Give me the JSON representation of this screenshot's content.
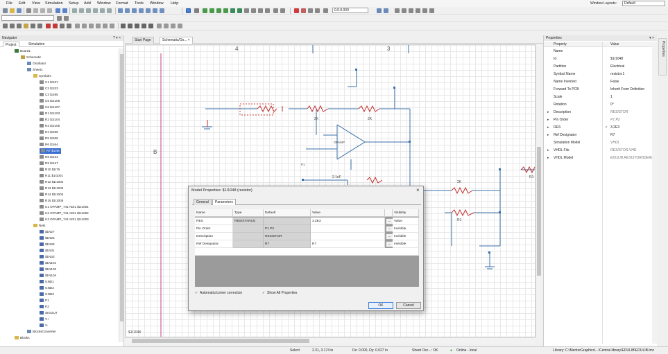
{
  "menu": [
    "File",
    "Edit",
    "View",
    "Simulation",
    "Setup",
    "Add",
    "Window",
    "Format",
    "Tools",
    "Window",
    "Help"
  ],
  "window_layouts": {
    "label": "Window Layouts:",
    "value": "Default"
  },
  "toolbar": {
    "zoom_value": "0.0.0.000"
  },
  "navigator": {
    "title": "Navigator",
    "tabs": [
      "Project",
      "Simulation"
    ],
    "tree": [
      {
        "label": "Board1",
        "level": 1,
        "icon": "board-icon"
      },
      {
        "label": "Schematic",
        "level": 2,
        "icon": "schematic-icon"
      },
      {
        "label": "Oscillator",
        "level": 3,
        "icon": "sheet-icon"
      },
      {
        "label": "Sheet1",
        "level": 3,
        "icon": "sheet-icon"
      },
      {
        "label": "Symbols",
        "level": 4,
        "icon": "folder-icon"
      },
      {
        "label": "C1 $1I27",
        "level": 5,
        "icon": "symbol-icon"
      },
      {
        "label": "C2 $1I33",
        "level": 5,
        "icon": "symbol-icon"
      },
      {
        "label": "C3 $1I95",
        "level": 5,
        "icon": "symbol-icon"
      },
      {
        "label": "C5 $1I106",
        "level": 5,
        "icon": "symbol-icon"
      },
      {
        "label": "C6 $1I107",
        "level": 5,
        "icon": "symbol-icon"
      },
      {
        "label": "R1 $1I103",
        "level": 5,
        "icon": "symbol-icon"
      },
      {
        "label": "R2 $1I104",
        "level": 5,
        "icon": "symbol-icon"
      },
      {
        "label": "R3 $1I105",
        "level": 5,
        "icon": "symbol-icon"
      },
      {
        "label": "R4 $1I65",
        "level": 5,
        "icon": "symbol-icon"
      },
      {
        "label": "R5 $1I66",
        "level": 5,
        "icon": "symbol-icon"
      },
      {
        "label": "R6 $1I64",
        "level": 5,
        "icon": "symbol-icon"
      },
      {
        "label": "R7 $1I48",
        "level": 5,
        "icon": "symbol-icon",
        "selected": true
      },
      {
        "label": "R8 $1I44",
        "level": 5,
        "icon": "symbol-icon"
      },
      {
        "label": "R9 $1I47",
        "level": 5,
        "icon": "symbol-icon"
      },
      {
        "label": "R10 $1I76",
        "level": 5,
        "icon": "symbol-icon"
      },
      {
        "label": "R11 $1I1001",
        "level": 5,
        "icon": "symbol-icon"
      },
      {
        "label": "R12 $1I1002",
        "level": 5,
        "icon": "symbol-icon"
      },
      {
        "label": "R13 $1I1003",
        "level": 5,
        "icon": "symbol-icon"
      },
      {
        "label": "R14 $1I1004",
        "level": 5,
        "icon": "symbol-icon"
      },
      {
        "label": "R15 $1I1005",
        "level": 5,
        "icon": "symbol-icon"
      },
      {
        "label": "U1 OPAMP_741 ADI1 $1I1001",
        "level": 5,
        "icon": "symbol-icon"
      },
      {
        "label": "U2 OPAMP_741 ADI1 $1I1002",
        "level": 5,
        "icon": "symbol-icon"
      },
      {
        "label": "U3 OPAMP_741 ADI1 $1I1003",
        "level": 5,
        "icon": "symbol-icon"
      },
      {
        "label": "Nets",
        "level": 4,
        "icon": "folder-icon"
      },
      {
        "label": "$1N27",
        "level": 5,
        "icon": "net-icon"
      },
      {
        "label": "$1N25",
        "level": 5,
        "icon": "net-icon"
      },
      {
        "label": "$1N28",
        "level": 5,
        "icon": "net-icon"
      },
      {
        "label": "$1N31",
        "level": 5,
        "icon": "net-icon"
      },
      {
        "label": "$1N33",
        "level": 5,
        "icon": "net-icon"
      },
      {
        "label": "$1N101",
        "level": 5,
        "icon": "net-icon"
      },
      {
        "label": "$1N103",
        "level": 5,
        "icon": "net-icon"
      },
      {
        "label": "$1N104",
        "level": 5,
        "icon": "net-icon"
      },
      {
        "label": "GND1",
        "level": 5,
        "icon": "net-icon"
      },
      {
        "label": "GND2",
        "level": 5,
        "icon": "net-icon"
      },
      {
        "label": "GND3",
        "level": 5,
        "icon": "net-icon"
      },
      {
        "label": "P1",
        "level": 5,
        "icon": "net-icon"
      },
      {
        "label": "P2",
        "level": 5,
        "icon": "net-icon"
      },
      {
        "label": "SIGOUT",
        "level": 5,
        "icon": "net-icon"
      },
      {
        "label": "V+",
        "level": 5,
        "icon": "net-icon"
      },
      {
        "label": "V-",
        "level": 5,
        "icon": "net-icon"
      },
      {
        "label": "BlocksConverter",
        "level": 3,
        "icon": "sheet-icon"
      },
      {
        "label": "Blocks",
        "level": 1,
        "icon": "folder-icon"
      }
    ]
  },
  "doc_tabs": [
    "Start Page",
    "Schematic/Os..."
  ],
  "canvas": {
    "zone_labels": {
      "top_left": "4",
      "top_right": "3",
      "side": "B"
    },
    "component_labels": [
      "2K",
      "2K",
      "2K",
      "OPAMP",
      "P1",
      "2.1nF",
      "R1",
      "R1"
    ],
    "footer": "$1I1048"
  },
  "dialog": {
    "title": "Model Properties: $1I1048 (resistor)",
    "tabs": [
      "General",
      "Parameters"
    ],
    "columns": [
      "Name",
      "Type",
      "Default",
      "Value",
      "",
      "Visibility"
    ],
    "rows": [
      {
        "name": "RES",
        "type": "RESISTANCE",
        "default": "",
        "value": "3.2E3",
        "visibility": "Value"
      },
      {
        "name": "Pin Order",
        "type": "",
        "default": "P1 P2",
        "value": "",
        "visibility": "Invisible"
      },
      {
        "name": "Description",
        "type": "",
        "default": "RESISTOR",
        "value": "",
        "visibility": "Invisible"
      },
      {
        "name": "Ref Designator",
        "type": "",
        "default": "R?",
        "value": "R7",
        "visibility": "Invisible"
      }
    ],
    "checks": [
      "Automatic/corner correction",
      "Show All Properties"
    ],
    "ok": "OK",
    "cancel": "Cancel"
  },
  "properties": {
    "title": "Properties",
    "header": {
      "property": "Property",
      "value": "Value"
    },
    "sidetab": "Properties",
    "rows": [
      {
        "name": "Name",
        "value": "",
        "exp": "",
        "chk": ""
      },
      {
        "name": "Id",
        "value": "$1I1048",
        "exp": "",
        "chk": ""
      },
      {
        "name": "Partition",
        "value": "Electrical",
        "exp": "",
        "chk": ""
      },
      {
        "name": "Symbol Name",
        "value": "resistor.1",
        "exp": "",
        "chk": ""
      },
      {
        "name": "Name Inverted",
        "value": "False",
        "exp": "",
        "chk": ""
      },
      {
        "name": "Forward To PCB",
        "value": "Inherit From Definition",
        "exp": "",
        "chk": ""
      },
      {
        "name": "Scale",
        "value": "1",
        "exp": "",
        "chk": ""
      },
      {
        "name": "Rotation",
        "value": "0°",
        "exp": "",
        "chk": ""
      },
      {
        "name": "Description",
        "value": "RESISTOR",
        "italic": true,
        "exp": "▸",
        "chk": ""
      },
      {
        "name": "Pin Order",
        "value": "P1 P2",
        "italic": true,
        "exp": "▸",
        "chk": ""
      },
      {
        "name": "RES",
        "value": "3.2E3",
        "exp": "▸",
        "chk": "✓"
      },
      {
        "name": "Ref Designator",
        "value": "R7",
        "exp": "▸",
        "chk": ""
      },
      {
        "name": "Simulation Model",
        "value": "VHDL",
        "italic": true,
        "exp": "",
        "chk": ""
      },
      {
        "name": "VHDL File",
        "value": "RESISTOR.VHD",
        "italic": true,
        "exp": "▸",
        "chk": ""
      },
      {
        "name": "VHDL Model",
        "value": "EDULIB.RESISTOR(IDEAL)",
        "italic": true,
        "exp": "▸",
        "chk": ""
      }
    ]
  },
  "status": {
    "mode": "Select",
    "coords": "2.31, 3.174 in",
    "delta": "Dx: 0.000, Dy: 0.027 in",
    "sheet": "Sheet Osc...: OK",
    "online": "Online - local",
    "library": "Library: C:\\MentorGraphics\\...\\Central library\\EDULIB\\EDULIB.lmc"
  }
}
